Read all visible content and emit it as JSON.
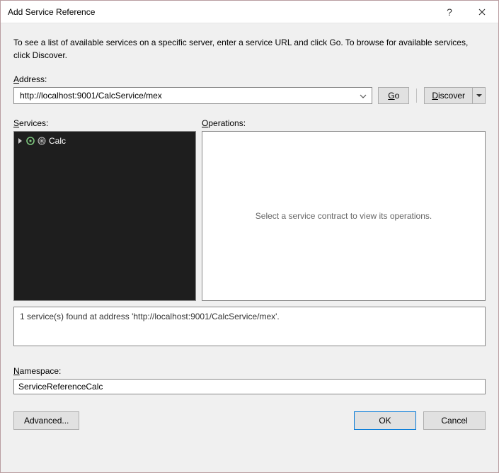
{
  "window": {
    "title": "Add Service Reference"
  },
  "intro": "To see a list of available services on a specific server, enter a service URL and click Go. To browse for available services, click Discover.",
  "address": {
    "label": "Address:",
    "value": "http://localhost:9001/CalcService/mex"
  },
  "buttons": {
    "go": "Go",
    "discover": "Discover",
    "advanced": "Advanced...",
    "ok": "OK",
    "cancel": "Cancel"
  },
  "servicesLabel": "Services:",
  "operationsLabel": "Operations:",
  "services": {
    "items": [
      {
        "name": "Calc"
      }
    ]
  },
  "operationsPlaceholder": "Select a service contract to view its operations.",
  "status": "1 service(s) found at address 'http://localhost:9001/CalcService/mex'.",
  "namespace": {
    "label": "Namespace:",
    "value": "ServiceReferenceCalc"
  }
}
